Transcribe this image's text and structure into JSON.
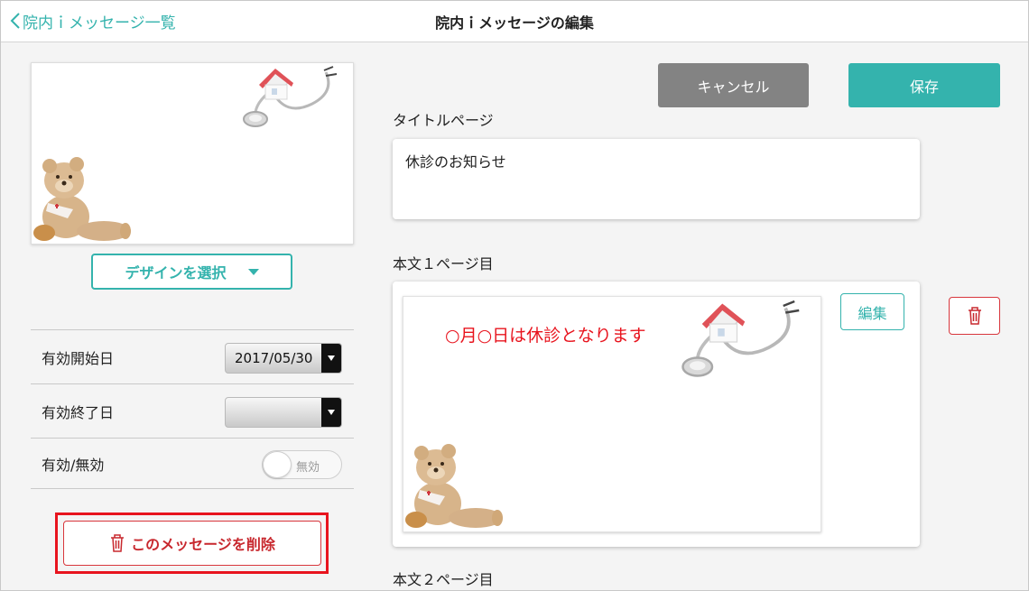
{
  "header": {
    "back_label": "院内ｉメッセージ一覧",
    "title": "院内ｉメッセージの編集"
  },
  "left": {
    "design_button": "デザインを選択",
    "settings": [
      {
        "label": "有効開始日",
        "value": "2017/05/30"
      },
      {
        "label": "有効終了日",
        "value": ""
      },
      {
        "label": "有効/無効",
        "toggle": "無効"
      }
    ],
    "delete_button": "このメッセージを削除"
  },
  "toolbar": {
    "cancel_label": "キャンセル",
    "save_label": "保存"
  },
  "title_section": {
    "label": "タイトルページ",
    "value": "休診のお知らせ"
  },
  "pages": [
    {
      "label": "本文１ページ目",
      "message": "○月○日は休診となります",
      "edit_label": "編集"
    },
    {
      "label": "本文２ページ目"
    }
  ],
  "colors": {
    "accent": "#34b3ad",
    "danger": "#d8363c",
    "highlight": "#e8141e",
    "cancel": "#838383"
  }
}
